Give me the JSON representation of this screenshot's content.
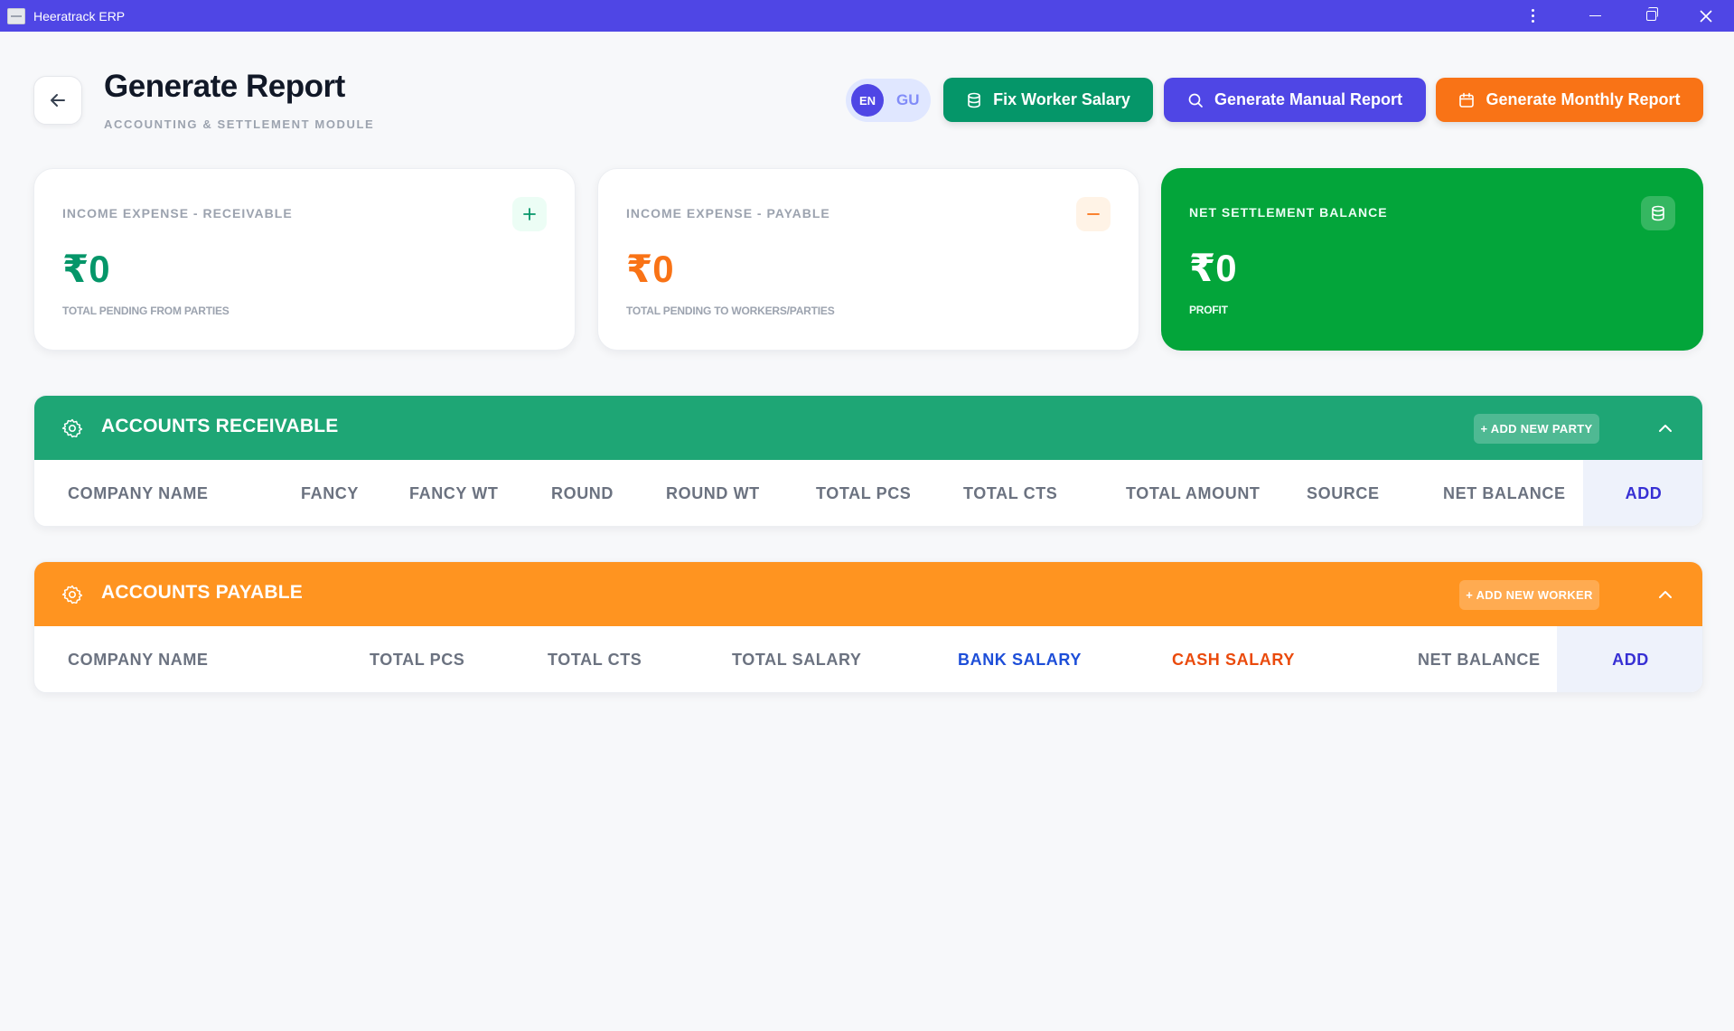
{
  "window": {
    "title": "Heeratrack ERP"
  },
  "header": {
    "title": "Generate Report",
    "subtitle": "ACCOUNTING & SETTLEMENT MODULE",
    "lang": {
      "en": "EN",
      "gu": "GU",
      "active": "EN"
    },
    "buttons": {
      "fix_salary": "Fix Worker Salary",
      "manual_report": "Generate Manual Report",
      "monthly_report": "Generate Monthly Report"
    }
  },
  "cards": {
    "receivable": {
      "label": "INCOME EXPENSE - RECEIVABLE",
      "amount": "₹0",
      "note": "TOTAL PENDING FROM PARTIES",
      "icon": "plus-icon"
    },
    "payable": {
      "label": "INCOME EXPENSE - PAYABLE",
      "amount": "₹0",
      "note": "TOTAL PENDING TO WORKERS/PARTIES",
      "icon": "minus-icon"
    },
    "net": {
      "label": "NET SETTLEMENT BALANCE",
      "amount": "₹0",
      "note": "PROFIT",
      "icon": "database-icon"
    }
  },
  "receivable": {
    "title": "ACCOUNTS RECEIVABLE",
    "add_button": "+ ADD NEW PARTY",
    "columns": [
      "COMPANY NAME",
      "FANCY",
      "FANCY WT",
      "ROUND",
      "ROUND WT",
      "TOTAL PCS",
      "TOTAL CTS",
      "TOTAL AMOUNT",
      "SOURCE",
      "NET BALANCE",
      "ADD"
    ]
  },
  "payable": {
    "title": "ACCOUNTS PAYABLE",
    "add_button": "+ ADD NEW WORKER",
    "columns": [
      "COMPANY NAME",
      "TOTAL PCS",
      "TOTAL CTS",
      "TOTAL SALARY",
      "BANK SALARY",
      "CASH SALARY",
      "NET BALANCE",
      "ADD"
    ]
  },
  "colors": {
    "titlebar": "#4f46e5",
    "green": "#059669",
    "indigo": "#4f46e5",
    "orange": "#f97316",
    "net_card": "#03a53a",
    "receivable_header": "#1ea675",
    "payable_header": "#ff9420"
  }
}
